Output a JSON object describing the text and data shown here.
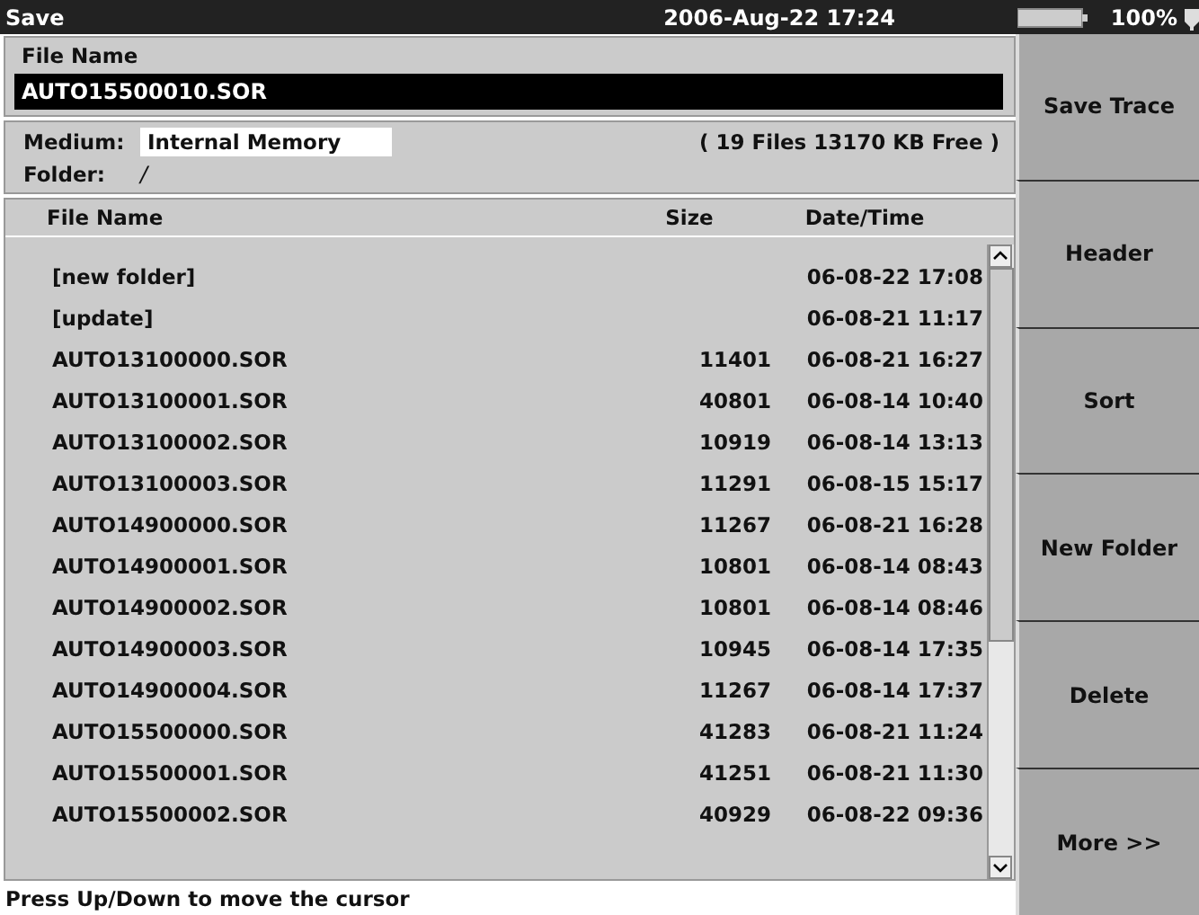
{
  "title_bar": {
    "title": "Save",
    "datetime": "2006-Aug-22 17:24",
    "battery": "100%"
  },
  "file_name": {
    "label": "File Name",
    "value": "AUTO15500010.SOR"
  },
  "medium": {
    "label": "Medium:",
    "value": "Internal Memory",
    "summary": "( 19 Files   13170 KB Free )"
  },
  "folder": {
    "label": "Folder:",
    "value": "/"
  },
  "table": {
    "columns": [
      "File Name",
      "Size",
      "Date/Time"
    ],
    "rows": [
      {
        "name": "[new folder]",
        "size": "",
        "date": "06-08-22 17:08"
      },
      {
        "name": "[update]",
        "size": "",
        "date": "06-08-21 11:17"
      },
      {
        "name": "AUTO13100000.SOR",
        "size": "11401",
        "date": "06-08-21 16:27"
      },
      {
        "name": "AUTO13100001.SOR",
        "size": "40801",
        "date": "06-08-14 10:40"
      },
      {
        "name": "AUTO13100002.SOR",
        "size": "10919",
        "date": "06-08-14 13:13"
      },
      {
        "name": "AUTO13100003.SOR",
        "size": "11291",
        "date": "06-08-15 15:17"
      },
      {
        "name": "AUTO14900000.SOR",
        "size": "11267",
        "date": "06-08-21 16:28"
      },
      {
        "name": "AUTO14900001.SOR",
        "size": "10801",
        "date": "06-08-14 08:43"
      },
      {
        "name": "AUTO14900002.SOR",
        "size": "10801",
        "date": "06-08-14 08:46"
      },
      {
        "name": "AUTO14900003.SOR",
        "size": "10945",
        "date": "06-08-14 17:35"
      },
      {
        "name": "AUTO14900004.SOR",
        "size": "11267",
        "date": "06-08-14 17:37"
      },
      {
        "name": "AUTO15500000.SOR",
        "size": "41283",
        "date": "06-08-21 11:24"
      },
      {
        "name": "AUTO15500001.SOR",
        "size": "41251",
        "date": "06-08-21 11:30"
      },
      {
        "name": "AUTO15500002.SOR",
        "size": "40929",
        "date": "06-08-22 09:36"
      }
    ]
  },
  "status_bar": "Press Up/Down to move the cursor",
  "soft_keys": [
    "Save Trace",
    "Header",
    "Sort",
    "New Folder",
    "Delete",
    "More >>"
  ]
}
